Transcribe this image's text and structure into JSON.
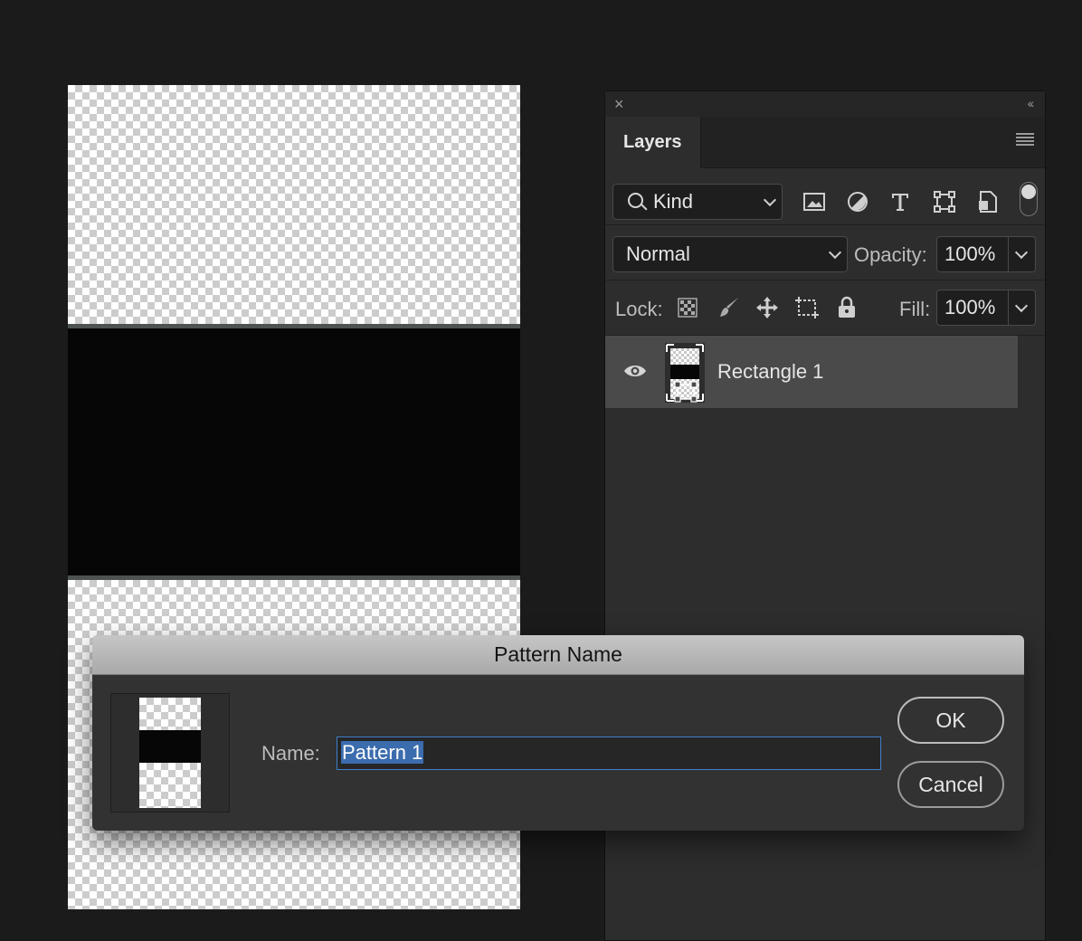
{
  "layers_panel": {
    "tab_label": "Layers",
    "filter": {
      "kind_label": "Kind"
    },
    "blend_mode": "Normal",
    "opacity_label": "Opacity:",
    "opacity_value": "100%",
    "lock_label": "Lock:",
    "fill_label": "Fill:",
    "fill_value": "100%",
    "layers": [
      {
        "name": "Rectangle 1",
        "visible": true
      }
    ]
  },
  "dialog": {
    "title": "Pattern Name",
    "name_label": "Name:",
    "name_value": "Pattern 1",
    "ok_label": "OK",
    "cancel_label": "Cancel"
  },
  "colors": {
    "selection": "#3b6cae",
    "focus_border": "#3f7ec7",
    "panel_bg": "#2d2d2d"
  }
}
